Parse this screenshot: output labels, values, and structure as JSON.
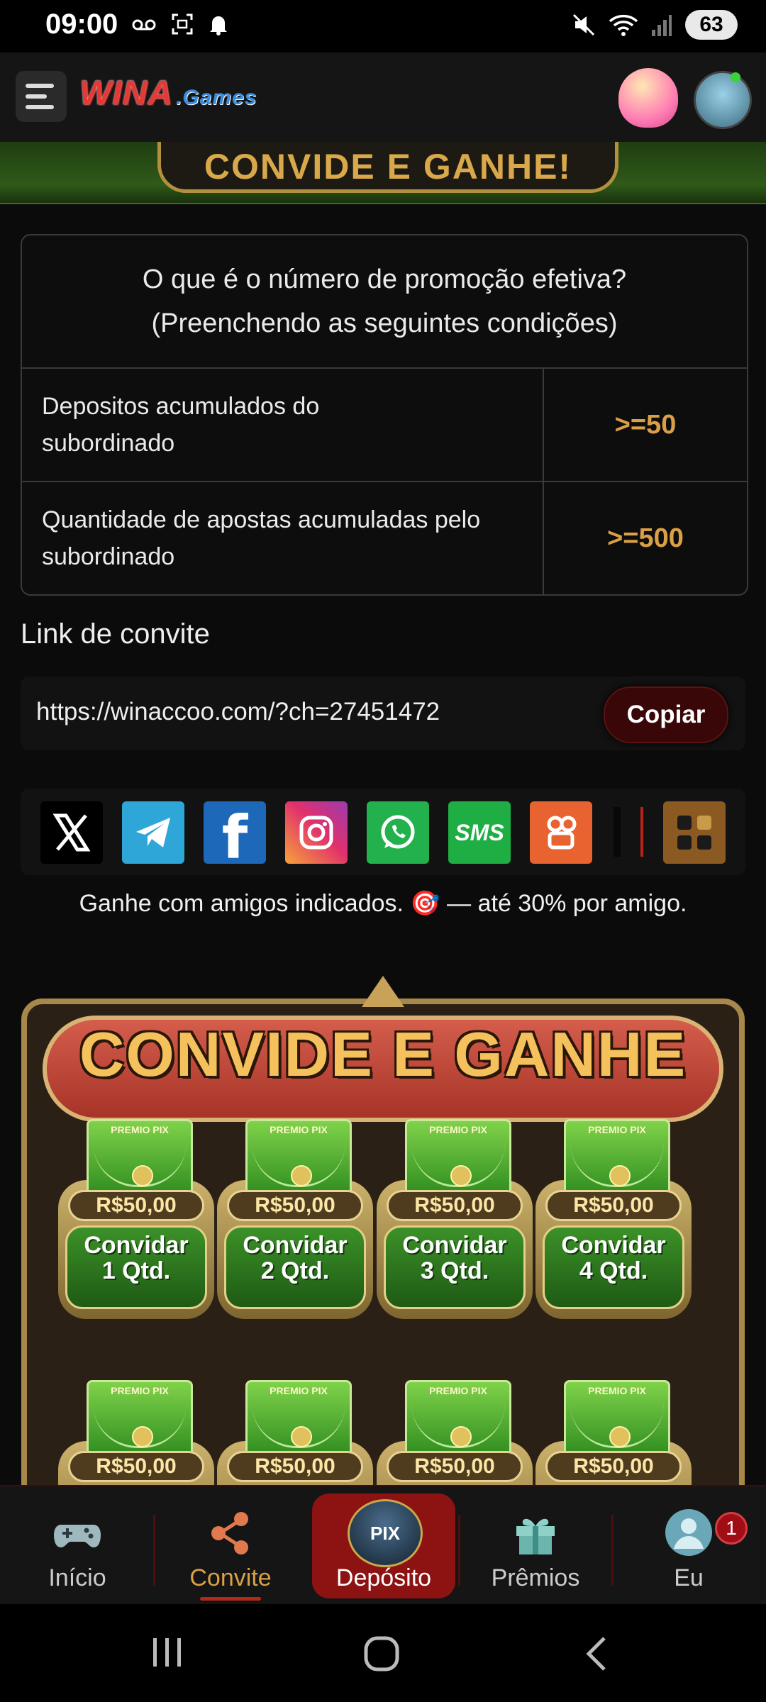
{
  "status_bar": {
    "time": "09:00",
    "battery": "63"
  },
  "header": {
    "logo_main": "WINA",
    "logo_sub": ".Games"
  },
  "banner": {
    "text": "CONVIDE E GANHE!"
  },
  "promo_table": {
    "heading_line1": "O que é o número de promoção efetiva?",
    "heading_line2": "(Preenchendo as seguintes condições)",
    "rows": [
      {
        "label": "Depositos acumulados do subordinado",
        "value": ">=50"
      },
      {
        "label": "Quantidade de apostas acumuladas pelo subordinado",
        "value": ">=500"
      }
    ]
  },
  "invite_link": {
    "title": "Link de convite",
    "url": "https://winaccoo.com/?ch=27451472",
    "copy_label": "Copiar"
  },
  "share": {
    "buttons": [
      {
        "name": "x",
        "glyph": "X",
        "color": "#000000"
      },
      {
        "name": "telegram",
        "glyph": "➤",
        "color": "#2fa6d8"
      },
      {
        "name": "facebook",
        "glyph": "f",
        "color": "#1d68b8"
      },
      {
        "name": "instagram",
        "glyph": "◎",
        "color": "#e1306c"
      },
      {
        "name": "whatsapp",
        "glyph": "✆",
        "color": "#22b14c"
      },
      {
        "name": "sms",
        "glyph": "SMS",
        "color": "#1fae44"
      },
      {
        "name": "kwai",
        "glyph": "▣",
        "color": "#e8632f"
      }
    ],
    "more_color": "#8a5a22"
  },
  "note": "Ganhe com amigos indicados. 🎯 — até 30% por amigo.",
  "invite_panel": {
    "title": "CONVIDE E GANHE",
    "envelope_label": "PREMIO PIX",
    "cards": [
      {
        "amount": "R$50,00",
        "line1": "Convidar",
        "line2": "1 Qtd."
      },
      {
        "amount": "R$50,00",
        "line1": "Convidar",
        "line2": "2 Qtd."
      },
      {
        "amount": "R$50,00",
        "line1": "Convidar",
        "line2": "3 Qtd."
      },
      {
        "amount": "R$50,00",
        "line1": "Convidar",
        "line2": "4 Qtd."
      },
      {
        "amount": "R$50,00",
        "line1": "",
        "line2": ""
      },
      {
        "amount": "R$50,00",
        "line1": "",
        "line2": ""
      },
      {
        "amount": "R$50,00",
        "line1": "",
        "line2": ""
      },
      {
        "amount": "R$50,00",
        "line1": "",
        "line2": ""
      }
    ]
  },
  "bottom_nav": {
    "items": [
      {
        "label": "Início",
        "icon": "gamepad-icon"
      },
      {
        "label": "Convite",
        "icon": "share-icon"
      },
      {
        "label": "Depósito",
        "icon": "pix-icon"
      },
      {
        "label": "Prêmios",
        "icon": "gift-icon"
      },
      {
        "label": "Eu",
        "icon": "user-icon"
      }
    ],
    "badge": "1",
    "pix_text": "PIX"
  },
  "colors": {
    "accent_gold": "#d9a045",
    "active_red": "#8d1212",
    "copy_button": "#3a0708"
  }
}
